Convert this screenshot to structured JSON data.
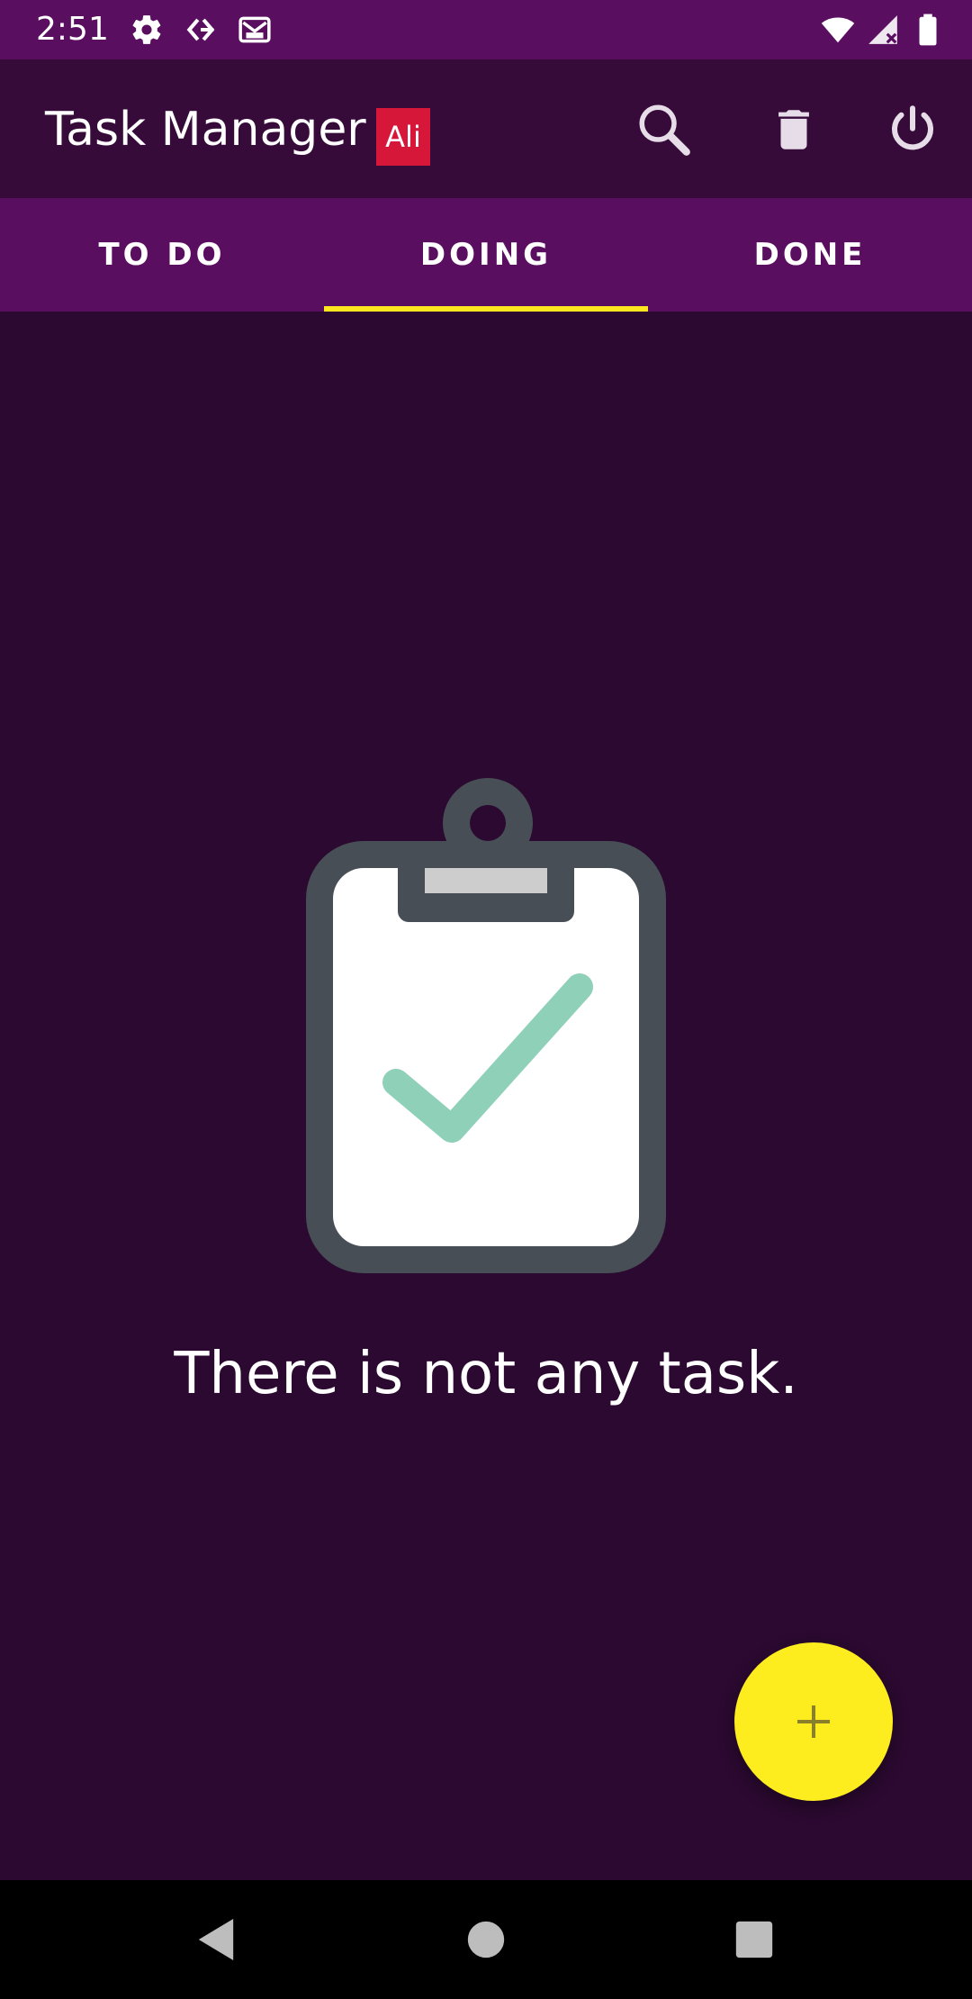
{
  "status_bar": {
    "time": "2:51",
    "icons": [
      "gear-icon",
      "cast-icon",
      "gmail-icon",
      "wifi-icon",
      "cell-signal-icon",
      "battery-icon"
    ]
  },
  "app_bar": {
    "title": "Task Manager",
    "user_badge": "Ali",
    "actions": [
      "search-icon",
      "trash-icon",
      "power-icon"
    ]
  },
  "tabs": [
    {
      "label": "TO DO",
      "selected": false
    },
    {
      "label": "DOING",
      "selected": true
    },
    {
      "label": "DONE",
      "selected": false
    }
  ],
  "empty_state": {
    "message": "There is not any task.",
    "icon": "clipboard-check-icon"
  },
  "fab": {
    "icon": "plus-icon"
  },
  "nav_bar": {
    "icons": [
      "back-icon",
      "home-icon",
      "recents-icon"
    ]
  },
  "colors": {
    "status_bar": "#5a0e60",
    "app_bar": "#360b3a",
    "background": "#2b0930",
    "tab_indicator": "#fde71f",
    "fab": "#fded1f",
    "badge": "#d6173a",
    "check": "#8fd0b9"
  }
}
